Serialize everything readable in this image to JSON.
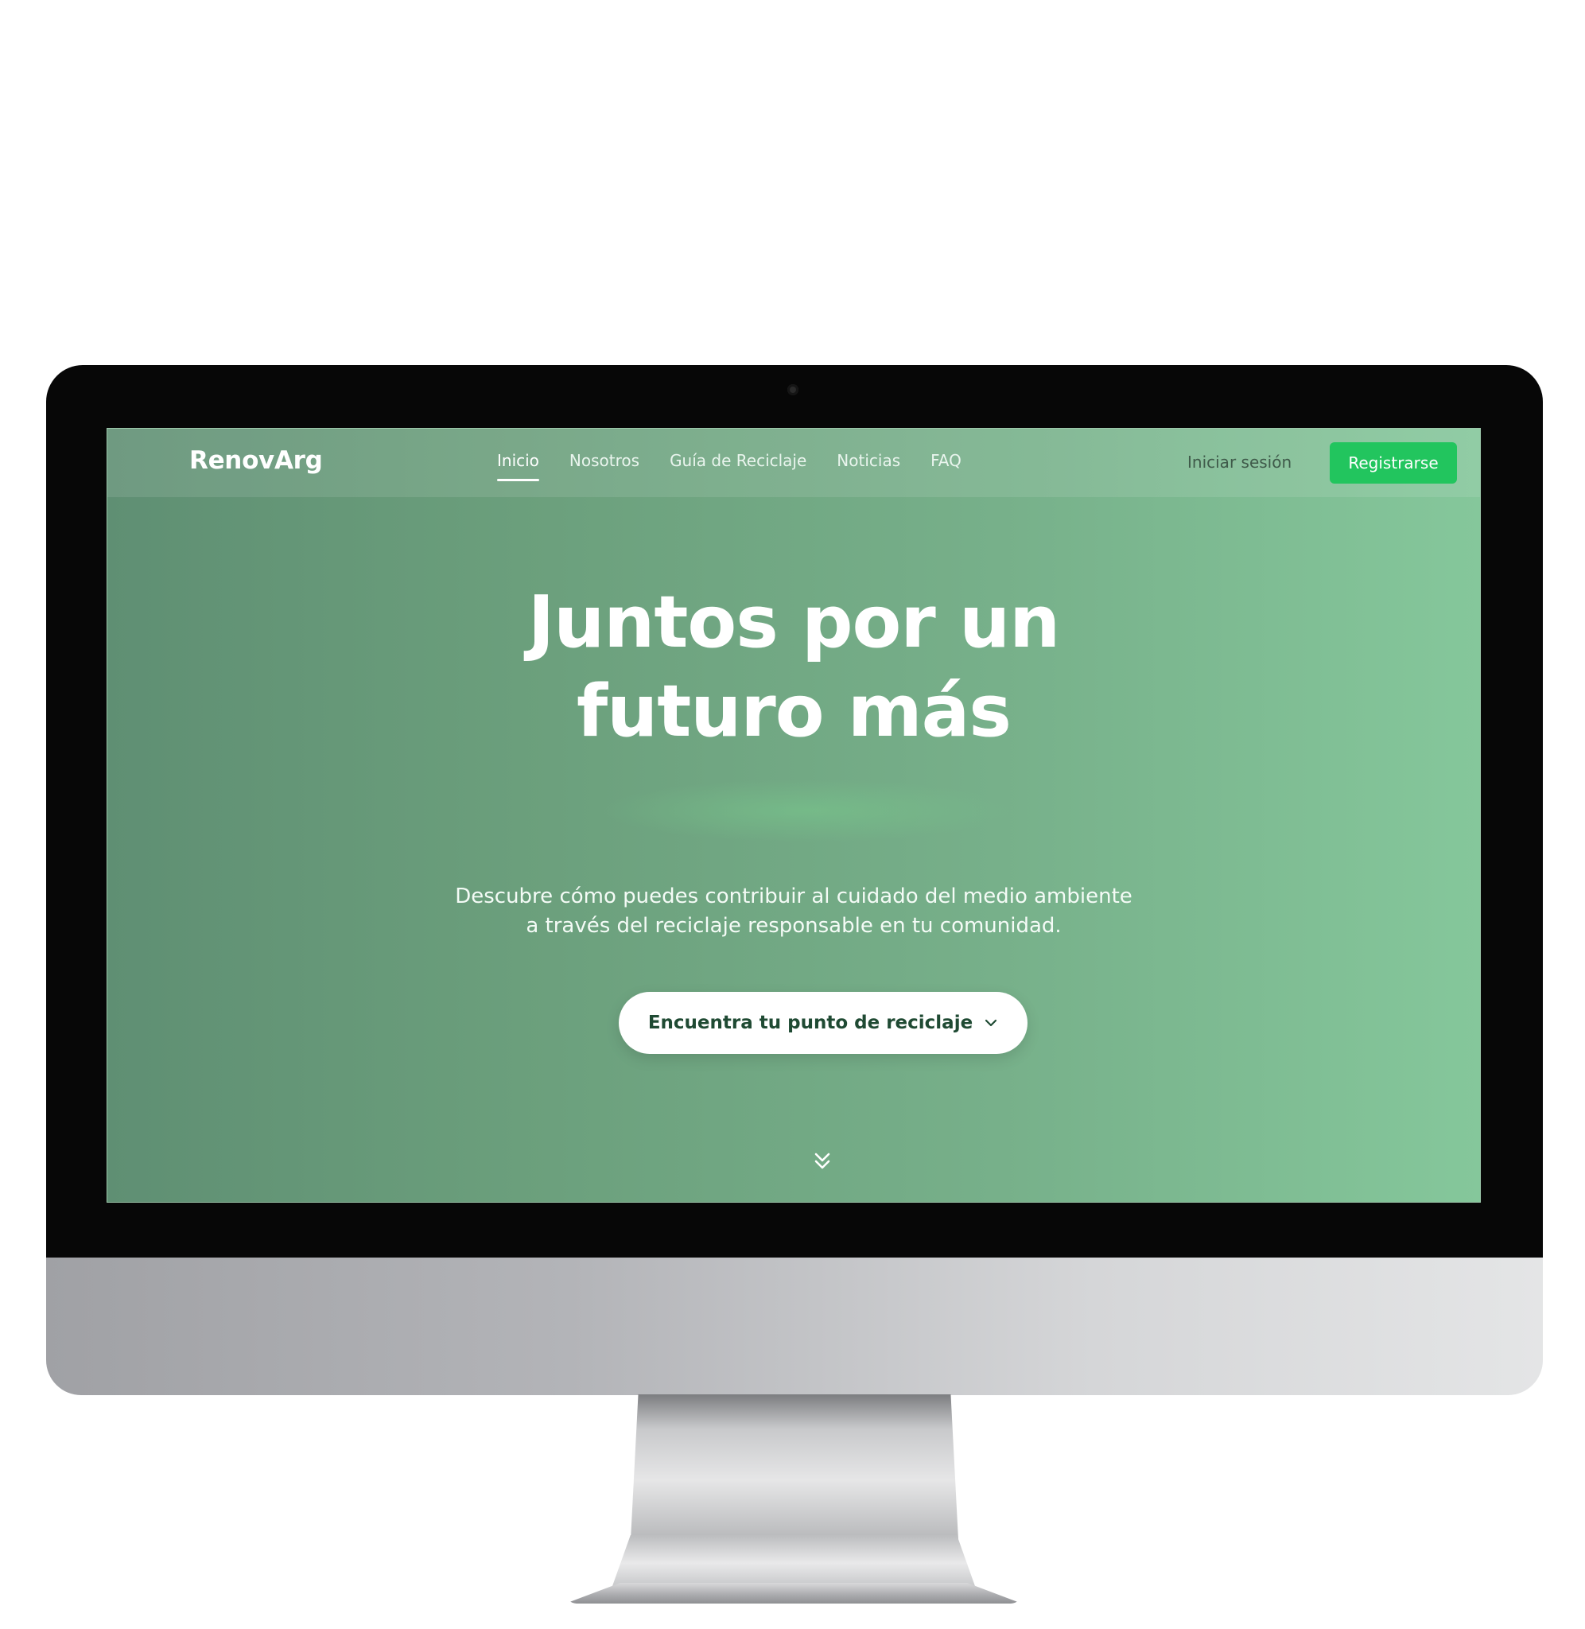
{
  "app": {
    "brand": "RenovArg"
  },
  "nav": {
    "items": [
      {
        "label": "Inicio",
        "active": true
      },
      {
        "label": "Nosotros",
        "active": false
      },
      {
        "label": "Guía de Reciclaje",
        "active": false
      },
      {
        "label": "Noticias",
        "active": false
      },
      {
        "label": "FAQ",
        "active": false
      }
    ],
    "login_label": "Iniciar sesión",
    "register_label": "Registrarse"
  },
  "hero": {
    "title_line1": "Juntos por un",
    "title_line2": "futuro más",
    "subtitle_line1": "Descubre cómo puedes contribuir al cuidado del medio ambiente",
    "subtitle_line2": "a través del reciclaje responsable en tu comunidad.",
    "cta_label": "Encuentra tu punto de reciclaje",
    "cta_icon": "chevron-down-icon",
    "scroll_icon": "double-chevron-down-icon"
  },
  "colors": {
    "accent": "#22c55e",
    "hero_gradient_start": "#5f8f73",
    "hero_gradient_end": "#85c79b",
    "cta_text": "#1f4a33"
  }
}
